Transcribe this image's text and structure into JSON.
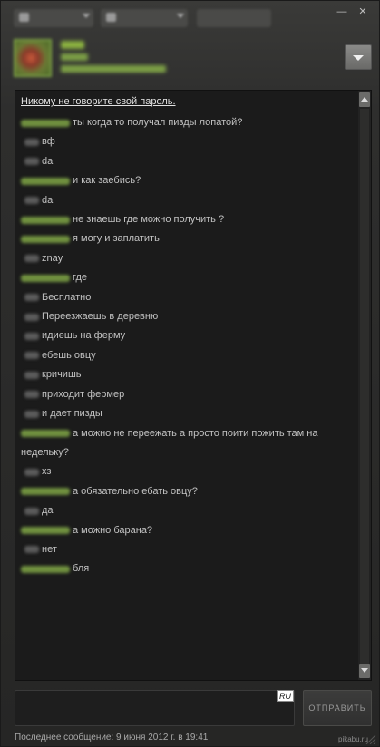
{
  "window": {
    "minimize_icon": "minimize-icon",
    "close_icon": "close-icon"
  },
  "header": {
    "dropdown_icon": "chevron-down-icon"
  },
  "chat": {
    "warning": "Никому не говорите свой пароль.",
    "messages": [
      {
        "from": "friend",
        "text": "ты когда то получал пизды лопатой?"
      },
      {
        "from": "self",
        "text": "вф"
      },
      {
        "from": "self",
        "text": "da"
      },
      {
        "from": "friend",
        "text": "и как заебись?"
      },
      {
        "from": "self",
        "text": "da"
      },
      {
        "from": "friend",
        "text": "не знаешь где можно получить ?"
      },
      {
        "from": "friend",
        "text": "я могу и заплатить"
      },
      {
        "from": "self",
        "text": "znay"
      },
      {
        "from": "friend",
        "text": "где"
      },
      {
        "from": "self",
        "text": "Бесплатно"
      },
      {
        "from": "self",
        "text": "Переезжаешь в деревню"
      },
      {
        "from": "self",
        "text": "идиешь на ферму"
      },
      {
        "from": "self",
        "text": "ебешь овцу"
      },
      {
        "from": "self",
        "text": "кричишь"
      },
      {
        "from": "self",
        "text": "приходит фермер"
      },
      {
        "from": "self",
        "text": "и дает пизды"
      },
      {
        "from": "friend",
        "text": "а можно не переежать а просто поити пожить там на недельку?"
      },
      {
        "from": "self",
        "text": "хз"
      },
      {
        "from": "friend",
        "text": "а обязательно ебать овцу?"
      },
      {
        "from": "self",
        "text": "да"
      },
      {
        "from": "friend",
        "text": "а можно барана?"
      },
      {
        "from": "self",
        "text": "нет"
      },
      {
        "from": "friend",
        "text": "бля"
      }
    ]
  },
  "composer": {
    "lang": "RU",
    "send_label": "ОТПРАВИТЬ"
  },
  "footer": {
    "last_message": "Последнее сообщение: 9 июня 2012 г. в 19:41",
    "watermark": "pikabu.ru"
  },
  "colors": {
    "friend_name": "#7da046",
    "background": "#1b1b1b"
  }
}
